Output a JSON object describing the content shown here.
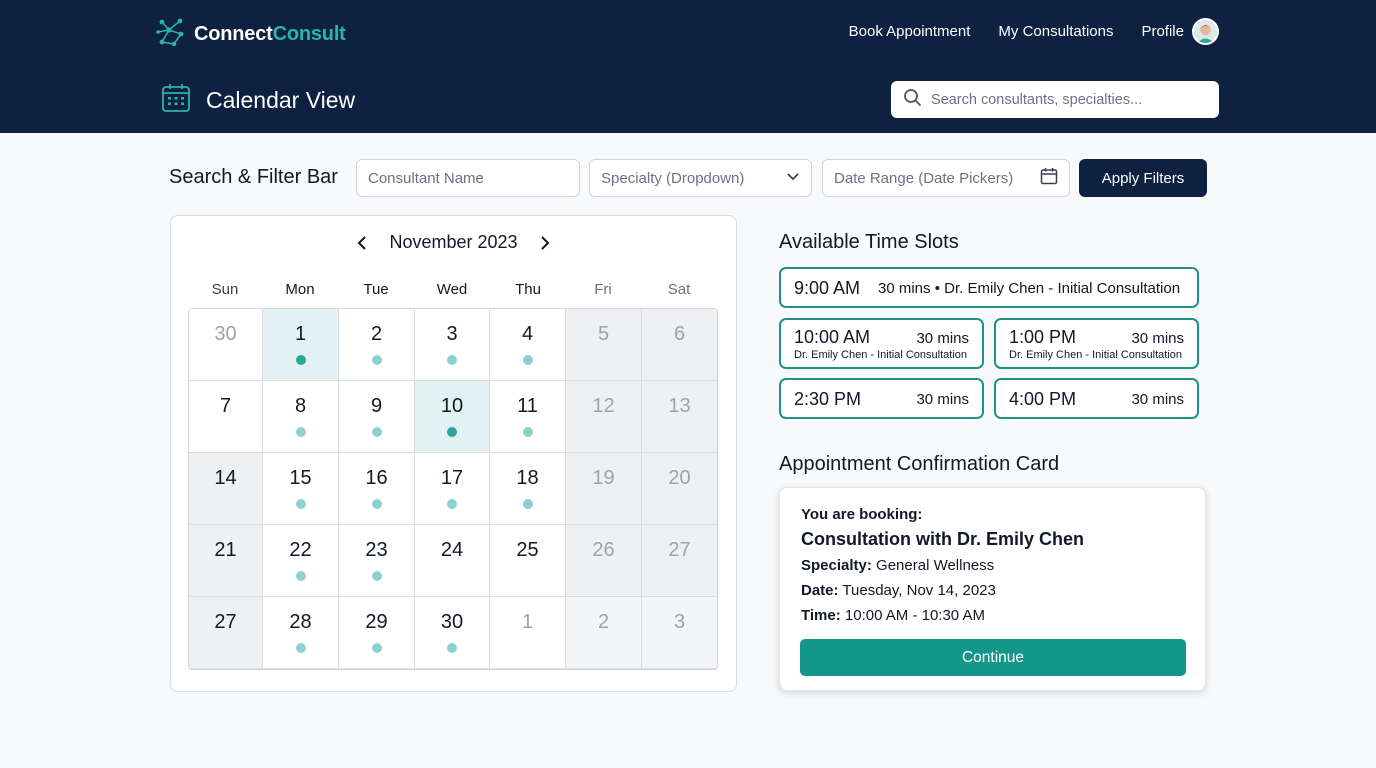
{
  "brand": {
    "name_primary": "Connect",
    "name_accent": "Consult"
  },
  "nav": {
    "book": "Book Appointment",
    "consultations": "My Consultations",
    "profile": "Profile"
  },
  "page": {
    "title": "Calendar View"
  },
  "search": {
    "placeholder": "Search consultants, specialties..."
  },
  "filters": {
    "title": "Search & Filter Bar",
    "consultant_placeholder": "Consultant Name",
    "specialty": "Specialty (Dropdown)",
    "date_range": "Date Range (Date Pickers)",
    "apply": "Apply Filters"
  },
  "calendar": {
    "month": "November 2023",
    "weekdays": [
      "Sun",
      "Mon",
      "Tue",
      "Wed",
      "Thu",
      "Fri",
      "Sat"
    ],
    "weeks": [
      [
        "30",
        "1",
        "2",
        "3",
        "4",
        "5",
        "6"
      ],
      [
        "7",
        "8",
        "9",
        "10",
        "11",
        "12",
        "13"
      ],
      [
        "14",
        "15",
        "16",
        "17",
        "18",
        "19",
        "20"
      ],
      [
        "21",
        "22",
        "23",
        "24",
        "25",
        "26",
        "27"
      ],
      [
        "27",
        "28",
        "29",
        "30",
        "1",
        "2",
        "3"
      ]
    ]
  },
  "slots": {
    "title": "Available Time Slots",
    "items": [
      {
        "time": "9:00 AM",
        "duration": "30 mins",
        "detail": "30 mins • Dr. Emily Chen - Initial Consultation"
      },
      {
        "time": "10:00 AM",
        "duration": "30 mins",
        "detail": "Dr. Emily Chen - Initial Consultation"
      },
      {
        "time": "1:00 PM",
        "duration": "30 mins",
        "detail": "Dr. Emily Chen - Initial Consultation"
      },
      {
        "time": "2:30 PM",
        "duration": "30 mins"
      },
      {
        "time": "4:00 PM",
        "duration": "30 mins"
      }
    ]
  },
  "confirmation": {
    "title": "Appointment Confirmation Card",
    "intro": "You are booking:",
    "heading": "Consultation with Dr. Emily Chen",
    "specialty_label": "Specialty:",
    "specialty": "General Wellness",
    "date_label": "Date:",
    "date": "Tuesday, Nov 14, 2023",
    "time_label": "Time:",
    "time": "10:00 AM - 10:30 AM",
    "continue": "Continue"
  },
  "colors": {
    "navy": "#0e2140",
    "teal": "#14968a",
    "accent_text": "#2bb3a5"
  }
}
